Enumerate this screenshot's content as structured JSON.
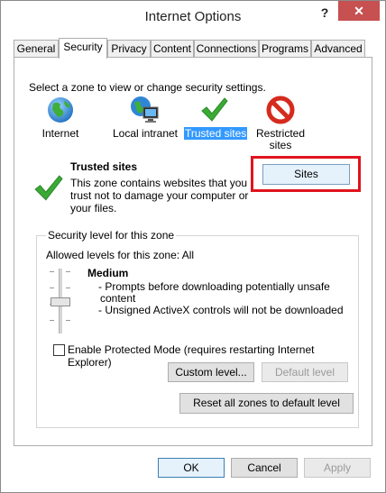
{
  "window": {
    "title": "Internet Options",
    "help_label": "?",
    "close_label": "✕"
  },
  "tabs": [
    {
      "label": "General"
    },
    {
      "label": "Security"
    },
    {
      "label": "Privacy"
    },
    {
      "label": "Content"
    },
    {
      "label": "Connections"
    },
    {
      "label": "Programs"
    },
    {
      "label": "Advanced"
    }
  ],
  "security": {
    "zone_prompt": "Select a zone to view or change security settings.",
    "zones": [
      {
        "label": "Internet",
        "icon": "globe-icon"
      },
      {
        "label": "Local intranet",
        "icon": "network-computer-icon"
      },
      {
        "label": "Trusted sites",
        "icon": "checkmark-icon"
      },
      {
        "label_line1": "Restricted",
        "label_line2": "sites",
        "icon": "restricted-icon"
      }
    ],
    "selected_zone": {
      "title": "Trusted sites",
      "description_line1": "This zone contains websites that you",
      "description_line2": "trust not to damage your computer or",
      "description_line3": "your files.",
      "sites_button": "Sites"
    },
    "level_group": {
      "title": "Security level for this zone",
      "allowed_levels": "Allowed levels for this zone: All",
      "level_name": "Medium",
      "bullet1_line1": "- Prompts before downloading potentially unsafe",
      "bullet1_line2": "content",
      "bullet2": "- Unsigned ActiveX controls will not be downloaded",
      "protected_mode_label": "Enable Protected Mode (requires restarting Internet Explorer)",
      "protected_mode_checked": false,
      "custom_level_button": "Custom level...",
      "default_level_button": "Default level"
    },
    "reset_all_button": "Reset all zones to default level"
  },
  "footer": {
    "ok": "OK",
    "cancel": "Cancel",
    "apply": "Apply"
  },
  "colors": {
    "selection": "#3399ff",
    "highlight_box": "#e0141e",
    "close_button": "#c75050",
    "check_green": "#3aaa35"
  }
}
